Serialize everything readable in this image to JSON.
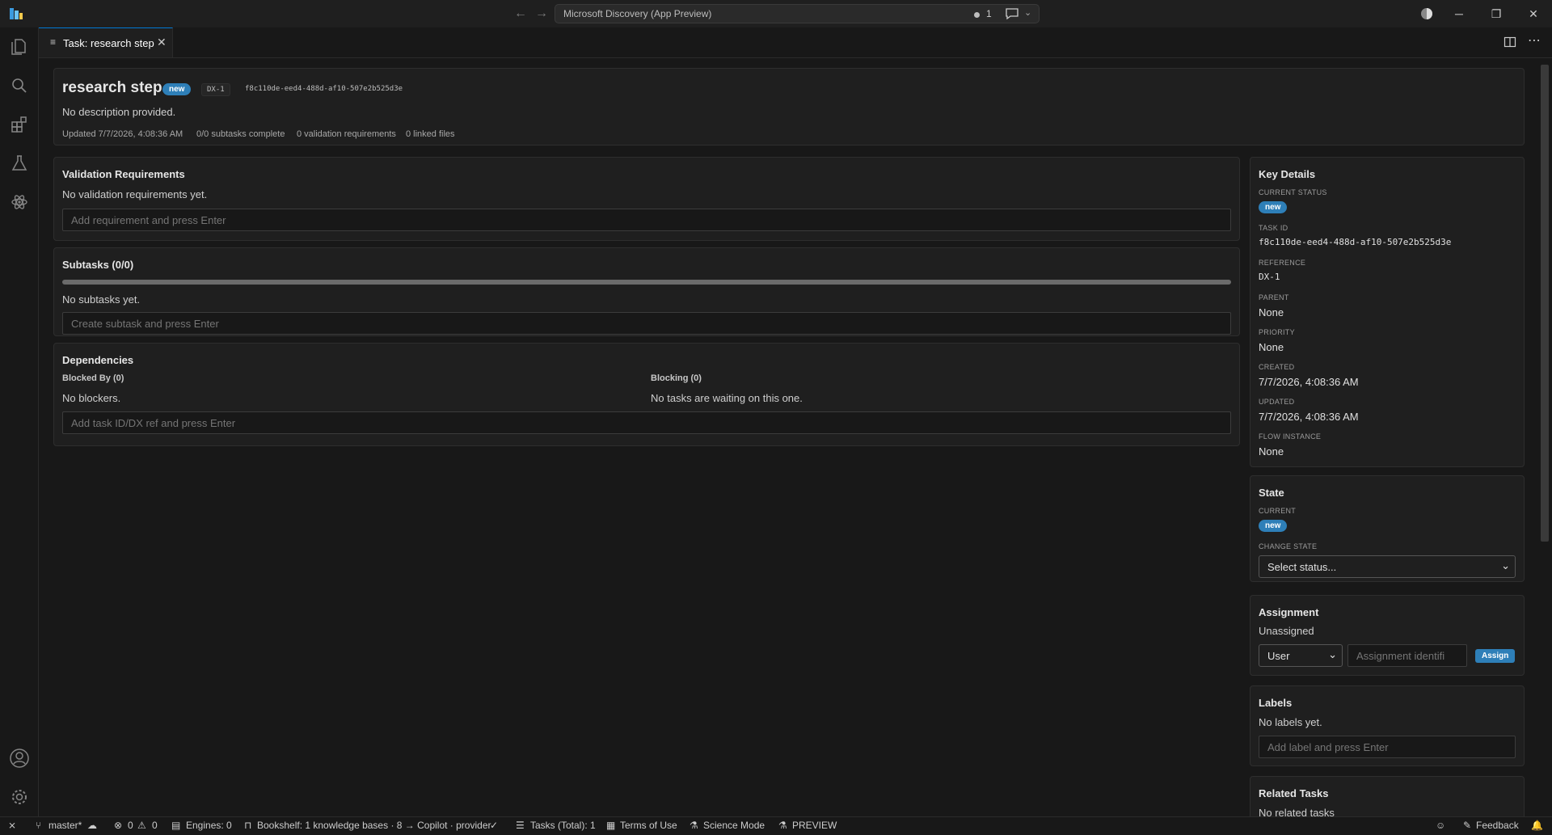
{
  "titlebar": {
    "command_center": "Microsoft Discovery (App Preview)",
    "notifications_count": "1"
  },
  "tab": {
    "title": "Task: research step"
  },
  "task": {
    "title": "research step",
    "status": "new",
    "ref": "DX-1",
    "id": "f8c110de-eed4-488d-af10-507e2b525d3e",
    "description": "No description provided.",
    "meta": {
      "updated": "Updated 7/7/2026, 4:08:36 AM",
      "subtasks": "0/0 subtasks complete",
      "validation": "0 validation requirements",
      "files": "0 linked files"
    }
  },
  "validation": {
    "title": "Validation Requirements",
    "empty": "No validation requirements yet.",
    "placeholder": "Add requirement and press Enter"
  },
  "subtasks": {
    "title": "Subtasks (0/0)",
    "progress": 0,
    "empty": "No subtasks yet.",
    "placeholder": "Create subtask and press Enter"
  },
  "dependencies": {
    "title": "Dependencies",
    "blocked_by_title": "Blocked By (0)",
    "blocked_by_empty": "No blockers.",
    "blocking_title": "Blocking (0)",
    "blocking_empty": "No tasks are waiting on this one.",
    "placeholder": "Add task ID/DX ref and press Enter"
  },
  "key_details": {
    "title": "Key Details",
    "status_label": "CURRENT STATUS",
    "status": "new",
    "task_id_label": "TASK ID",
    "task_id": "f8c110de-eed4-488d-af10-507e2b525d3e",
    "reference_label": "REFERENCE",
    "reference": "DX-1",
    "parent_label": "PARENT",
    "parent": "None",
    "priority_label": "PRIORITY",
    "priority": "None",
    "created_label": "CREATED",
    "created": "7/7/2026, 4:08:36 AM",
    "updated_label": "UPDATED",
    "updated": "7/7/2026, 4:08:36 AM",
    "flow_label": "FLOW INSTANCE",
    "flow": "None"
  },
  "state": {
    "title": "State",
    "current_label": "CURRENT",
    "current": "new",
    "change_label": "CHANGE STATE",
    "select": "Select status..."
  },
  "assignment": {
    "title": "Assignment",
    "value": "Unassigned",
    "type": "User",
    "placeholder": "Assignment identifi",
    "button": "Assign"
  },
  "labels": {
    "title": "Labels",
    "empty": "No labels yet.",
    "placeholder": "Add label and press Enter"
  },
  "related": {
    "title": "Related Tasks",
    "empty": "No related tasks"
  },
  "statusbar": {
    "branch": "master*",
    "problems_errors": "0",
    "problems_warnings": "0",
    "engines": "Engines: 0",
    "bookshelf": "Bookshelf: 1 knowledge bases · 8 → Copilot · provider",
    "tasks": "Tasks (Total): 1",
    "terms": "Terms of Use",
    "science": "Science Mode",
    "preview": "PREVIEW",
    "feedback": "Feedback"
  },
  "colors": {
    "accent": "#2e7fb8",
    "tab_border": "#0078d4",
    "bg": "#181818",
    "panel": "#1f1f1f"
  }
}
